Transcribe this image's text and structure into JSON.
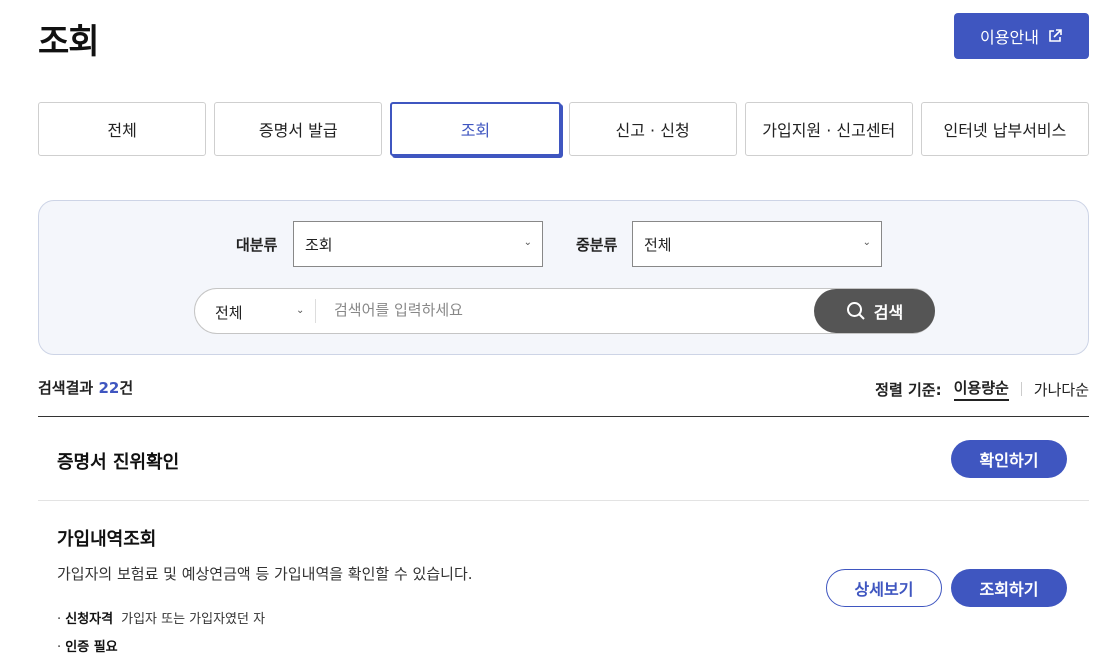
{
  "header": {
    "title": "조회",
    "guide_label": "이용안내"
  },
  "tabs": [
    {
      "label": "전체"
    },
    {
      "label": "증명서 발급"
    },
    {
      "label": "조회",
      "active": true
    },
    {
      "label": "신고 · 신청"
    },
    {
      "label": "가입지원 · 신고센터"
    },
    {
      "label": "인터넷 납부서비스"
    }
  ],
  "filter": {
    "major_label": "대분류",
    "major_value": "조회",
    "middle_label": "중분류",
    "middle_value": "전체",
    "search_scope": "전체",
    "search_placeholder": "검색어를 입력하세요",
    "search_button": "검색"
  },
  "results": {
    "prefix": "검색결과",
    "count": "22",
    "suffix": "건",
    "sort_label": "정렬 기준:",
    "sort_options": [
      "이용량순",
      "가나다순"
    ]
  },
  "items": [
    {
      "title": "증명서 진위확인",
      "primary_button": "확인하기"
    },
    {
      "title": "가입내역조회",
      "description": "가입자의 보험료 및 예상연금액 등 가입내역을 확인할 수 있습니다.",
      "detail_button": "상세보기",
      "primary_button": "조회하기",
      "eligibility_label": "신청자격",
      "eligibility_value": "가입자 또는 가입자였던 자",
      "auth_label": "인증 필요"
    }
  ],
  "colors": {
    "accent": "#3f56c0",
    "search_button": "#555555"
  }
}
